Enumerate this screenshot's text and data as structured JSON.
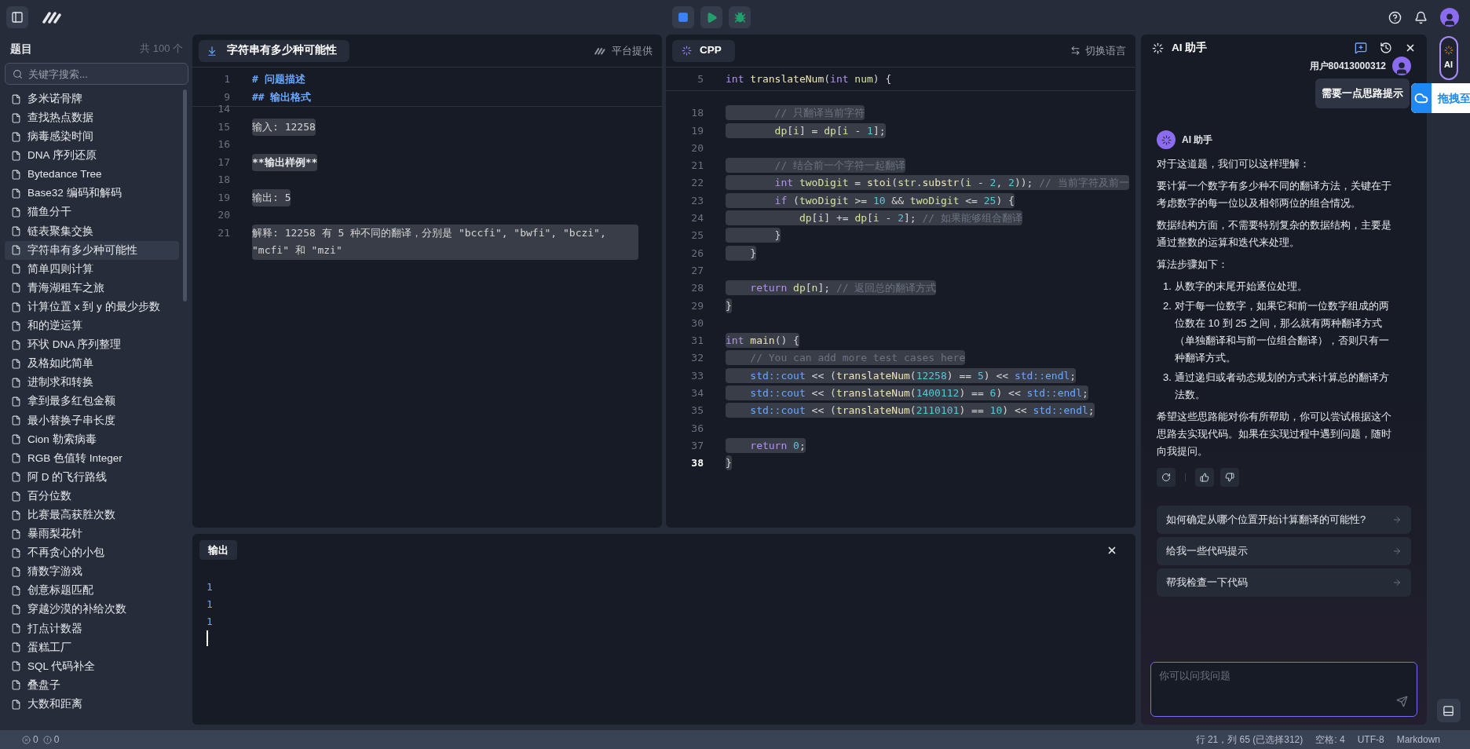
{
  "sidebar": {
    "title": "题目",
    "count": "共 100 个",
    "search": {
      "placeholder": "关键字搜索..."
    },
    "items": [
      {
        "label": "多米诺骨牌",
        "selected": false
      },
      {
        "label": "查找热点数据",
        "selected": false
      },
      {
        "label": "病毒感染时间",
        "selected": false
      },
      {
        "label": "DNA 序列还原",
        "selected": false
      },
      {
        "label": "Bytedance Tree",
        "selected": false
      },
      {
        "label": "Base32 编码和解码",
        "selected": false
      },
      {
        "label": "猫鱼分干",
        "selected": false
      },
      {
        "label": "链表聚集交换",
        "selected": false
      },
      {
        "label": "字符串有多少种可能性",
        "selected": true
      },
      {
        "label": "简单四则计算",
        "selected": false
      },
      {
        "label": "青海湖租车之旅",
        "selected": false
      },
      {
        "label": "计算位置 x 到 y 的最少步数",
        "selected": false
      },
      {
        "label": "和的逆运算",
        "selected": false
      },
      {
        "label": "环状 DNA 序列整理",
        "selected": false
      },
      {
        "label": "及格如此简单",
        "selected": false
      },
      {
        "label": "进制求和转换",
        "selected": false
      },
      {
        "label": "拿到最多红包金额",
        "selected": false
      },
      {
        "label": "最小替换子串长度",
        "selected": false
      },
      {
        "label": "Cion 勒索病毒",
        "selected": false
      },
      {
        "label": "RGB 色值转 Integer",
        "selected": false
      },
      {
        "label": "阿 D 的飞行路线",
        "selected": false
      },
      {
        "label": "百分位数",
        "selected": false
      },
      {
        "label": "比赛最高获胜次数",
        "selected": false
      },
      {
        "label": "暴雨梨花针",
        "selected": false
      },
      {
        "label": "不再贪心的小包",
        "selected": false
      },
      {
        "label": "猜数字游戏",
        "selected": false
      },
      {
        "label": "创意标题匹配",
        "selected": false
      },
      {
        "label": "穿越沙漠的补给次数",
        "selected": false
      },
      {
        "label": "打点计数器",
        "selected": false
      },
      {
        "label": "蛋糕工厂",
        "selected": false
      },
      {
        "label": "SQL 代码补全",
        "selected": false
      },
      {
        "label": "叠盘子",
        "selected": false
      },
      {
        "label": "大数和距离",
        "selected": false
      }
    ]
  },
  "problem_editor": {
    "tab": "字符串有多少种可能性",
    "source": "平台提供",
    "selection_active": true,
    "sticky_lines": [
      {
        "number": "1",
        "text": "# 问题描述",
        "kind": "heading",
        "current": false
      },
      {
        "number": "9",
        "text": "## 输出格式",
        "kind": "heading",
        "current": false
      }
    ],
    "lines": [
      {
        "number": "14",
        "kind": "plain",
        "current": false
      },
      {
        "number": "15",
        "text": "输入: 12258",
        "kind": "plain",
        "current": false
      },
      {
        "number": "16",
        "kind": "plain",
        "current": false
      },
      {
        "number": "17",
        "text": "**输出样例**",
        "kind": "bold",
        "current": false
      },
      {
        "number": "18",
        "kind": "plain",
        "current": false
      },
      {
        "number": "19",
        "text": "输出: 5",
        "kind": "plain",
        "current": false
      },
      {
        "number": "20",
        "kind": "plain",
        "current": false
      },
      {
        "number": "21",
        "text": "解释: 12258 有 5 种不同的翻译，分别是 \"bccfi\", \"bwfi\", \"bczi\", \"mcfi\" 和 \"mzi\"",
        "kind": "plain",
        "current": false
      }
    ]
  },
  "code_editor": {
    "tab": "CPP",
    "action": "切换语言",
    "selection_active": true,
    "sticky_lines": [
      {
        "number": "5",
        "current": false,
        "tokens": [
          {
            "kind": "kw",
            "text": "int"
          },
          {
            "kind": "fn",
            "text": " translateNum"
          },
          {
            "kind": "plain",
            "text": "("
          },
          {
            "kind": "kw",
            "text": "int"
          },
          {
            "kind": "var",
            "text": " num"
          },
          {
            "kind": "plain",
            "text": ") {"
          }
        ]
      }
    ],
    "lines": [
      {
        "number": "18",
        "current": false,
        "tokens": [
          {
            "kind": "cm",
            "text": "        // 只翻译当前字符"
          }
        ]
      },
      {
        "number": "19",
        "current": false,
        "tokens": [
          {
            "kind": "var",
            "text": "        dp"
          },
          {
            "kind": "plain",
            "text": "["
          },
          {
            "kind": "var",
            "text": "i"
          },
          {
            "kind": "plain",
            "text": "] = "
          },
          {
            "kind": "var",
            "text": "dp"
          },
          {
            "kind": "plain",
            "text": "["
          },
          {
            "kind": "var",
            "text": "i"
          },
          {
            "kind": "plain",
            "text": " - "
          },
          {
            "kind": "num",
            "text": "1"
          },
          {
            "kind": "plain",
            "text": "];"
          }
        ]
      },
      {
        "number": "20",
        "current": false
      },
      {
        "number": "21",
        "current": false,
        "tokens": [
          {
            "kind": "cm",
            "text": "        // 结合前一个字符一起翻译"
          }
        ]
      },
      {
        "number": "22",
        "current": false,
        "tokens": [
          {
            "kind": "kw",
            "text": "        int"
          },
          {
            "kind": "var",
            "text": " twoDigit"
          },
          {
            "kind": "plain",
            "text": " = "
          },
          {
            "kind": "fn",
            "text": "stoi"
          },
          {
            "kind": "plain",
            "text": "("
          },
          {
            "kind": "var",
            "text": "str"
          },
          {
            "kind": "plain",
            "text": "."
          },
          {
            "kind": "fn",
            "text": "substr"
          },
          {
            "kind": "plain",
            "text": "("
          },
          {
            "kind": "var",
            "text": "i"
          },
          {
            "kind": "plain",
            "text": " - "
          },
          {
            "kind": "num",
            "text": "2"
          },
          {
            "kind": "plain",
            "text": ", "
          },
          {
            "kind": "num",
            "text": "2"
          },
          {
            "kind": "plain",
            "text": ")); "
          },
          {
            "kind": "cm",
            "text": "// 当前字符及前一"
          }
        ]
      },
      {
        "number": "23",
        "current": false,
        "tokens": [
          {
            "kind": "kw",
            "text": "        if"
          },
          {
            "kind": "plain",
            "text": " ("
          },
          {
            "kind": "var",
            "text": "twoDigit"
          },
          {
            "kind": "plain",
            "text": " >= "
          },
          {
            "kind": "num",
            "text": "10"
          },
          {
            "kind": "plain",
            "text": " && "
          },
          {
            "kind": "var",
            "text": "twoDigit"
          },
          {
            "kind": "plain",
            "text": " <= "
          },
          {
            "kind": "num",
            "text": "25"
          },
          {
            "kind": "plain",
            "text": ") {"
          }
        ]
      },
      {
        "number": "24",
        "current": false,
        "tokens": [
          {
            "kind": "var",
            "text": "            dp"
          },
          {
            "kind": "plain",
            "text": "["
          },
          {
            "kind": "var",
            "text": "i"
          },
          {
            "kind": "plain",
            "text": "] += "
          },
          {
            "kind": "var",
            "text": "dp"
          },
          {
            "kind": "plain",
            "text": "["
          },
          {
            "kind": "var",
            "text": "i"
          },
          {
            "kind": "plain",
            "text": " - "
          },
          {
            "kind": "num",
            "text": "2"
          },
          {
            "kind": "plain",
            "text": "]; "
          },
          {
            "kind": "cm",
            "text": "// 如果能够组合翻译"
          }
        ]
      },
      {
        "number": "25",
        "current": false,
        "tokens": [
          {
            "kind": "plain",
            "text": "        }"
          }
        ]
      },
      {
        "number": "26",
        "current": false,
        "tokens": [
          {
            "kind": "plain",
            "text": "    }"
          }
        ]
      },
      {
        "number": "27",
        "current": false
      },
      {
        "number": "28",
        "current": false,
        "tokens": [
          {
            "kind": "kw",
            "text": "    return"
          },
          {
            "kind": "var",
            "text": " dp"
          },
          {
            "kind": "plain",
            "text": "["
          },
          {
            "kind": "var",
            "text": "n"
          },
          {
            "kind": "plain",
            "text": "]; "
          },
          {
            "kind": "cm",
            "text": "// 返回总的翻译方式"
          }
        ]
      },
      {
        "number": "29",
        "current": false,
        "tokens": [
          {
            "kind": "plain",
            "text": "}"
          }
        ]
      },
      {
        "number": "30",
        "current": false
      },
      {
        "number": "31",
        "current": false,
        "tokens": [
          {
            "kind": "kw",
            "text": "int"
          },
          {
            "kind": "fn",
            "text": " main"
          },
          {
            "kind": "plain",
            "text": "() {"
          }
        ]
      },
      {
        "number": "32",
        "current": false,
        "tokens": [
          {
            "kind": "cm",
            "text": "    // You can add more test cases here"
          }
        ]
      },
      {
        "number": "33",
        "current": false,
        "tokens": [
          {
            "kind": "ns",
            "text": "    std::cout"
          },
          {
            "kind": "plain",
            "text": " << ("
          },
          {
            "kind": "fn",
            "text": "translateNum"
          },
          {
            "kind": "plain",
            "text": "("
          },
          {
            "kind": "num",
            "text": "12258"
          },
          {
            "kind": "plain",
            "text": ") == "
          },
          {
            "kind": "num",
            "text": "5"
          },
          {
            "kind": "plain",
            "text": ") << "
          },
          {
            "kind": "ns",
            "text": "std::endl"
          },
          {
            "kind": "plain",
            "text": ";"
          }
        ]
      },
      {
        "number": "34",
        "current": false,
        "tokens": [
          {
            "kind": "ns",
            "text": "    std::cout"
          },
          {
            "kind": "plain",
            "text": " << ("
          },
          {
            "kind": "fn",
            "text": "translateNum"
          },
          {
            "kind": "plain",
            "text": "("
          },
          {
            "kind": "num",
            "text": "1400112"
          },
          {
            "kind": "plain",
            "text": ") == "
          },
          {
            "kind": "num",
            "text": "6"
          },
          {
            "kind": "plain",
            "text": ") << "
          },
          {
            "kind": "ns",
            "text": "std::endl"
          },
          {
            "kind": "plain",
            "text": ";"
          }
        ]
      },
      {
        "number": "35",
        "current": false,
        "tokens": [
          {
            "kind": "ns",
            "text": "    std::cout"
          },
          {
            "kind": "plain",
            "text": " << ("
          },
          {
            "kind": "fn",
            "text": "translateNum"
          },
          {
            "kind": "plain",
            "text": "("
          },
          {
            "kind": "num",
            "text": "2110101"
          },
          {
            "kind": "plain",
            "text": ") == "
          },
          {
            "kind": "num",
            "text": "10"
          },
          {
            "kind": "plain",
            "text": ") << "
          },
          {
            "kind": "ns",
            "text": "std::endl"
          },
          {
            "kind": "plain",
            "text": ";"
          }
        ]
      },
      {
        "number": "36",
        "current": false
      },
      {
        "number": "37",
        "current": false,
        "tokens": [
          {
            "kind": "kw",
            "text": "    return"
          },
          {
            "kind": "num",
            "text": " 0"
          },
          {
            "kind": "plain",
            "text": ";"
          }
        ]
      },
      {
        "number": "38",
        "current": true,
        "tokens": [
          {
            "kind": "plain",
            "text": "}"
          }
        ]
      }
    ]
  },
  "output": {
    "tab": "输出",
    "lines": [
      "1",
      "1",
      "1"
    ]
  },
  "ai_panel": {
    "title": "AI 助手",
    "user_name": "用户80413000312",
    "user_message": "需要一点思路提示",
    "overlay_button": "拖拽至",
    "assistant_name": "AI 助手",
    "paragraphs": [
      "对于这道题，我们可以这样理解：",
      "要计算一个数字有多少种不同的翻译方法，关键在于考虑数字的每一位以及相邻两位的组合情况。",
      "数据结构方面，不需要特别复杂的数据结构，主要是通过整数的运算和迭代来处理。",
      "算法步骤如下："
    ],
    "steps": [
      {
        "marker": "1.",
        "text": "从数字的末尾开始逐位处理。"
      },
      {
        "marker": "2.",
        "text": "对于每一位数字，如果它和前一位数字组成的两位数在 10 到 25 之间，那么就有两种翻译方式（单独翻译和与前一位组合翻译），否则只有一种翻译方式。"
      },
      {
        "marker": "3.",
        "text": "通过递归或者动态规划的方式来计算总的翻译方法数。"
      }
    ],
    "closing": "希望这些思路能对你有所帮助，你可以尝试根据这个思路去实现代码。如果在实现过程中遇到问题，随时向我提问。",
    "suggestions": [
      "如何确定从哪个位置开始计算翻译的可能性?",
      "给我一些代码提示",
      "帮我检查一下代码"
    ],
    "input": {
      "placeholder": "你可以问我问题"
    }
  },
  "rail": {
    "ai_label": "AI"
  },
  "status_bar": {
    "errors": "0",
    "warnings": "0",
    "position": "行 21，列 65 (已选择312)",
    "indent": "空格: 4",
    "encoding": "UTF-8",
    "language": "Markdown"
  }
}
